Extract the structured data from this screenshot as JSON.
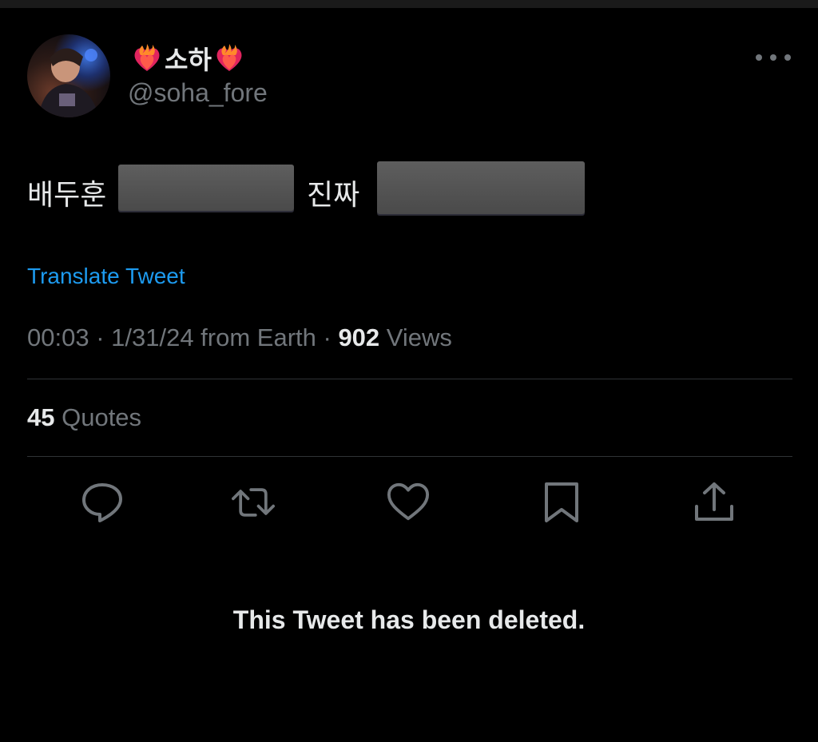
{
  "tweet": {
    "display_name": "소하",
    "name_emoji": "heart-on-fire-icon",
    "handle": "@soha_fore",
    "text_parts": [
      "배두훈",
      "진짜"
    ],
    "translate_label": "Translate Tweet",
    "timestamp": "00:03 · 1/31/24 from Earth · ",
    "views_count": "902",
    "views_label": " Views",
    "quotes_count": "45",
    "quotes_label": " Quotes",
    "deleted_notice": "This Tweet has been deleted."
  },
  "actions": [
    {
      "name": "reply-icon"
    },
    {
      "name": "retweet-icon"
    },
    {
      "name": "like-icon"
    },
    {
      "name": "bookmark-icon"
    },
    {
      "name": "share-icon"
    }
  ],
  "colors": {
    "background": "#000000",
    "text_primary": "#e7e9ea",
    "text_secondary": "#71767b",
    "link": "#1d9bf0",
    "divider": "#2f3336"
  }
}
